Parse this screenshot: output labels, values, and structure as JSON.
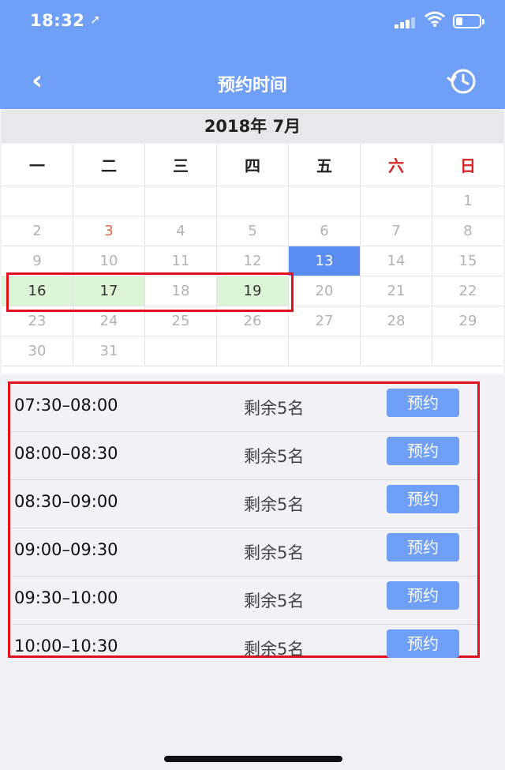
{
  "status_bar": {
    "time": "18:32"
  },
  "nav": {
    "title": "预约时间"
  },
  "calendar": {
    "month": "2018年 7月",
    "weekdays": [
      "一",
      "二",
      "三",
      "四",
      "五",
      "六",
      "日"
    ],
    "rows": [
      [
        "",
        "",
        "",
        "",
        "",
        "",
        "1"
      ],
      [
        "2",
        "3",
        "4",
        "5",
        "6",
        "7",
        "8"
      ],
      [
        "9",
        "10",
        "11",
        "12",
        "13",
        "14",
        "15"
      ],
      [
        "16",
        "17",
        "18",
        "19",
        "20",
        "21",
        "22"
      ],
      [
        "23",
        "24",
        "25",
        "26",
        "27",
        "28",
        "29"
      ],
      [
        "30",
        "31",
        "",
        "",
        "",
        "",
        ""
      ]
    ]
  },
  "slots": [
    {
      "time": "07:30–08:00",
      "remaining": "剩余5名",
      "button": "预约"
    },
    {
      "time": "08:00–08:30",
      "remaining": "剩余5名",
      "button": "预约"
    },
    {
      "time": "08:30–09:00",
      "remaining": "剩余5名",
      "button": "预约"
    },
    {
      "time": "09:00–09:30",
      "remaining": "剩余5名",
      "button": "预约"
    },
    {
      "time": "09:30–10:00",
      "remaining": "剩余5名",
      "button": "预约"
    },
    {
      "time": "10:00–10:30",
      "remaining": "剩余5名",
      "button": "预约"
    }
  ],
  "colors": {
    "header": "#6f9ff6",
    "today": "#5b8cf0",
    "available": "#dcf5d6",
    "weekend": "#d72020",
    "highlight_border": "#e0101e"
  },
  "icons": {
    "back": "chevron-left-icon",
    "history": "clock-history-icon"
  }
}
